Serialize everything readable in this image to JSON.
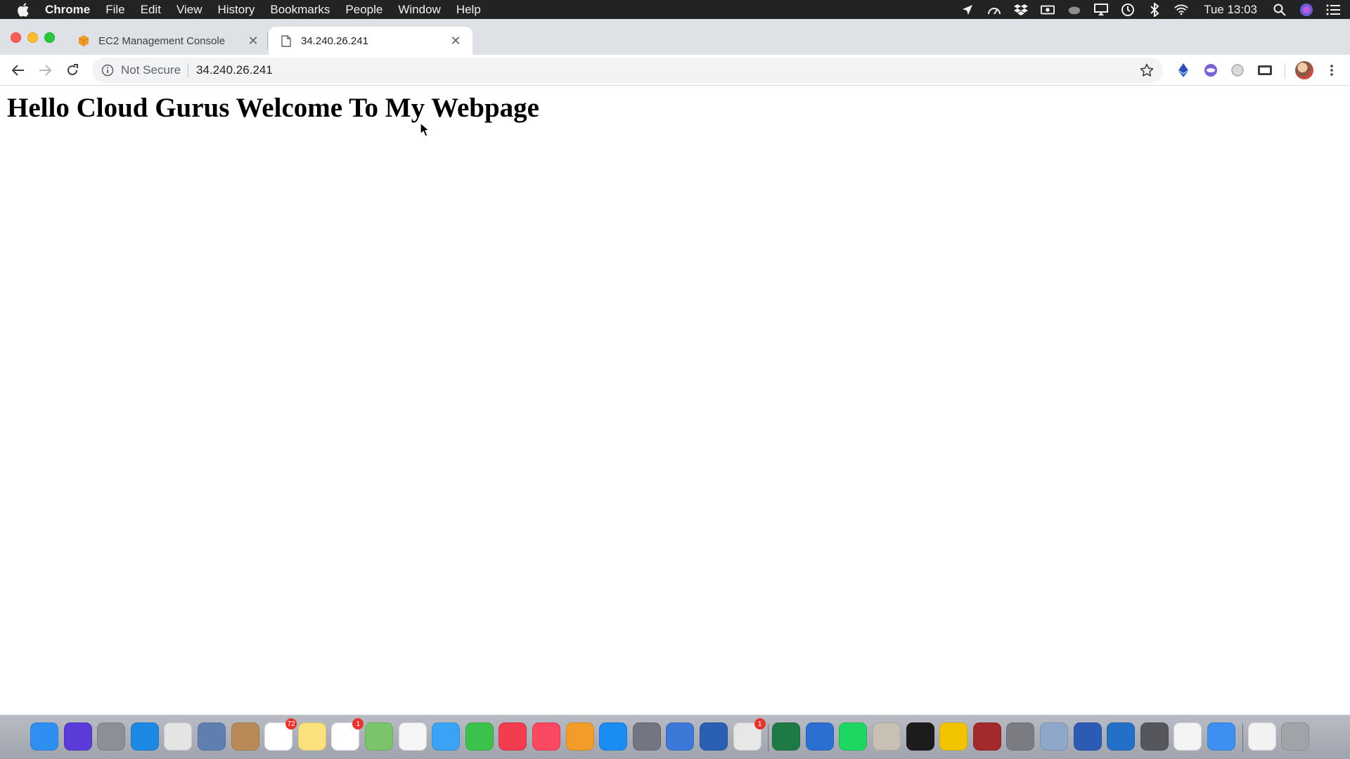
{
  "menubar": {
    "app_name": "Chrome",
    "items": [
      "File",
      "Edit",
      "View",
      "History",
      "Bookmarks",
      "People",
      "Window",
      "Help"
    ],
    "clock": "Tue 13:03"
  },
  "tabs": [
    {
      "title": "EC2 Management Console",
      "favicon": "aws-cube-icon",
      "active": false
    },
    {
      "title": "34.240.26.241",
      "favicon": "page-icon",
      "active": true
    }
  ],
  "omnibox": {
    "security_label": "Not Secure",
    "url": "34.240.26.241"
  },
  "page": {
    "heading": "Hello Cloud Gurus Welcome To My Webpage"
  },
  "dock": {
    "apps": [
      {
        "name": "finder",
        "color": "#2f8ff0"
      },
      {
        "name": "siri",
        "color": "#5a3bd8"
      },
      {
        "name": "launchpad",
        "color": "#8c8f96"
      },
      {
        "name": "safari",
        "color": "#1e88e5"
      },
      {
        "name": "chrome",
        "color": "#e4e4e4"
      },
      {
        "name": "mail-app",
        "color": "#5f7fb0"
      },
      {
        "name": "contacts",
        "color": "#b98a57"
      },
      {
        "name": "calendar",
        "color": "#ffffff",
        "badge": "72"
      },
      {
        "name": "notes",
        "color": "#fbe27c"
      },
      {
        "name": "reminders",
        "color": "#ffffff",
        "badge": "1"
      },
      {
        "name": "maps",
        "color": "#7cc46b"
      },
      {
        "name": "photos",
        "color": "#f6f6f6"
      },
      {
        "name": "messages",
        "color": "#3aa3f5"
      },
      {
        "name": "facetime",
        "color": "#3ac24c"
      },
      {
        "name": "news",
        "color": "#f23d4f"
      },
      {
        "name": "music",
        "color": "#f9485f"
      },
      {
        "name": "books",
        "color": "#f39c2a"
      },
      {
        "name": "app-store",
        "color": "#1b8cf4"
      },
      {
        "name": "system-preferences",
        "color": "#737680"
      },
      {
        "name": "network-utility",
        "color": "#3c78d8"
      },
      {
        "name": "remote-desktop",
        "color": "#2a5fb3"
      },
      {
        "name": "skype-s",
        "color": "#e7e7e7",
        "badge": "1"
      },
      {
        "name": "excel",
        "color": "#1d7a44"
      },
      {
        "name": "edge",
        "color": "#2b6fd1"
      },
      {
        "name": "spotify",
        "color": "#1ed760"
      },
      {
        "name": "script-editor",
        "color": "#c8c1b3"
      },
      {
        "name": "terminal",
        "color": "#1c1c1c"
      },
      {
        "name": "vpn-app",
        "color": "#f2c400"
      },
      {
        "name": "dictionary",
        "color": "#a32a2a"
      },
      {
        "name": "keyboard-app",
        "color": "#7a7c82"
      },
      {
        "name": "preview",
        "color": "#8fa7c8"
      },
      {
        "name": "word",
        "color": "#2b5bb5"
      },
      {
        "name": "vpn-peak",
        "color": "#2470c9"
      },
      {
        "name": "movie-app",
        "color": "#55575c"
      },
      {
        "name": "chart-app",
        "color": "#f3f3f3"
      },
      {
        "name": "keynote",
        "color": "#3d8ff0"
      },
      {
        "name": "documents-folder",
        "color": "#f2f2f2"
      },
      {
        "name": "trash",
        "color": "#a0a3a8"
      }
    ]
  }
}
